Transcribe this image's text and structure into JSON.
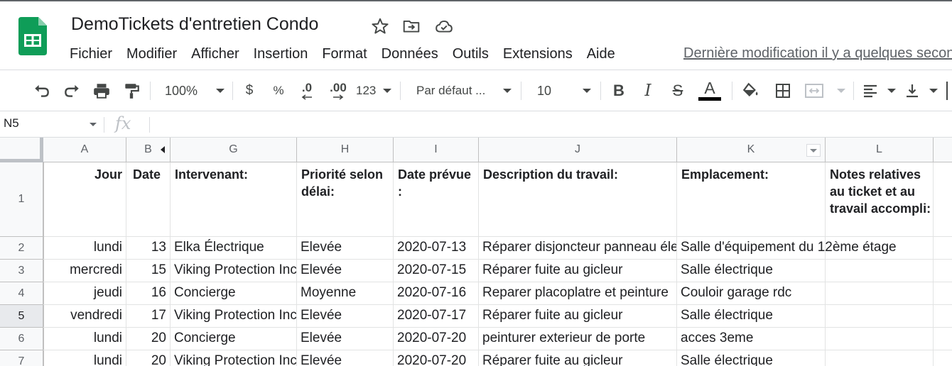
{
  "header": {
    "title": "DemoTickets d'entretien Condo",
    "last_edit": "Dernière modification il y a quelques secondes",
    "menu": [
      "Fichier",
      "Modifier",
      "Afficher",
      "Insertion",
      "Format",
      "Données",
      "Outils",
      "Extensions",
      "Aide"
    ]
  },
  "toolbar": {
    "zoom": "100%",
    "currency": "$",
    "percent": "%",
    "decrease_decimals": ".0",
    "increase_decimals": ".00",
    "more_formats": "123",
    "font": "Par défaut ...",
    "font_size": "10",
    "bold": "B",
    "italic": "I",
    "strike": "S",
    "text_color_letter": "A",
    "text_color": "#000000"
  },
  "formula_bar": {
    "cell_ref": "N5",
    "fx": "fx",
    "value": ""
  },
  "grid": {
    "columns": [
      "A",
      "B",
      "G",
      "H",
      "I",
      "J",
      "K",
      "L"
    ],
    "selected_row": "5",
    "header_row": {
      "row_number": "1",
      "cells": [
        "Jour",
        "Date",
        "Intervenant:",
        "Priorité selon délai:",
        "Date prévue :",
        "Description du travail:",
        "Emplacement:",
        "Notes relatives au ticket et au travail accompli:"
      ]
    },
    "rows": [
      {
        "num": "2",
        "cells": [
          "lundi",
          "13",
          "Elka Électrique",
          "Elevée",
          "2020-07-13",
          "Réparer disjoncteur panneau électrique",
          "Salle d'équipement du 12ème étage",
          ""
        ]
      },
      {
        "num": "3",
        "cells": [
          "mercredi",
          "15",
          "Viking Protection Incendie",
          "Elevée",
          "2020-07-15",
          "Réparer fuite au gicleur",
          "Salle électrique",
          ""
        ]
      },
      {
        "num": "4",
        "cells": [
          "jeudi",
          "16",
          "Concierge",
          "Moyenne",
          "2020-07-16",
          "Reparer placoplatre et peinture",
          "Couloir garage rdc",
          ""
        ]
      },
      {
        "num": "5",
        "cells": [
          "vendredi",
          "17",
          "Viking Protection Incendie",
          "Elevée",
          "2020-07-17",
          "Réparer fuite au gicleur",
          "Salle électrique",
          ""
        ]
      },
      {
        "num": "6",
        "cells": [
          "lundi",
          "20",
          "Concierge",
          "Elevée",
          "2020-07-20",
          "peinturer exterieur de porte",
          "acces 3eme",
          ""
        ]
      },
      {
        "num": "7",
        "cells": [
          "lundi",
          "20",
          "Viking Protection Incendie",
          "Elevée",
          "2020-07-20",
          "Réparer fuite au gicleur",
          "Salle électrique",
          ""
        ]
      }
    ]
  }
}
